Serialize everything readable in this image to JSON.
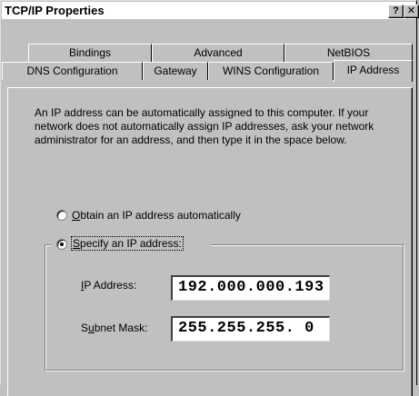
{
  "window": {
    "title": "TCP/IP Properties",
    "help_label": "?",
    "close_label": "✕"
  },
  "tabs_back": [
    {
      "label": "Bindings"
    },
    {
      "label": "Advanced"
    },
    {
      "label": "NetBIOS"
    }
  ],
  "tabs_front": [
    {
      "label": "DNS Configuration"
    },
    {
      "label": "Gateway"
    },
    {
      "label": "WINS Configuration"
    },
    {
      "label": "IP Address",
      "active": true
    }
  ],
  "description": "An IP address can be automatically assigned to this computer. If your network does not automatically assign IP addresses, ask your network administrator for an address, and then type it in the space below.",
  "options": {
    "obtain": {
      "label": "Obtain an IP address automatically",
      "accel": "O",
      "selected": false
    },
    "specify": {
      "label": "Specify an IP address:",
      "accel": "S",
      "selected": true
    }
  },
  "fields": {
    "ip": {
      "label": "IP Address:",
      "accel": "I",
      "value": "192.000.000.193"
    },
    "subnet": {
      "label": "Subnet Mask:",
      "accel": "u",
      "value": "255.255.255. 0"
    }
  }
}
